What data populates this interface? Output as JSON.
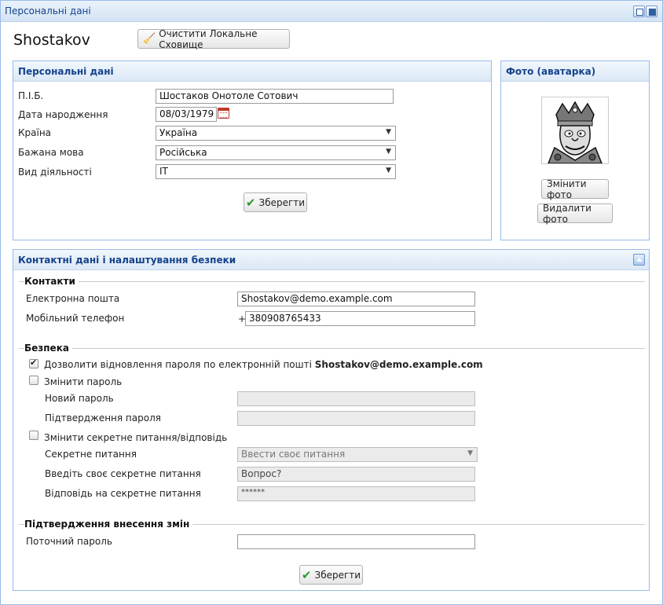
{
  "window": {
    "title": "Персональні дані"
  },
  "header": {
    "user_name": "Shostakov",
    "clear_storage_label": "Очистити Локальне Сховище"
  },
  "personal": {
    "title": "Персональні дані",
    "fields": {
      "fio_label": "П.І.Б.",
      "fio_value": "Шостаков Онотоле Сотович",
      "birth_label": "Дата народження",
      "birth_value": "08/03/1979",
      "country_label": "Країна",
      "country_value": "Україна",
      "language_label": "Бажана мова",
      "language_value": "Російська",
      "activity_label": "Вид діяльності",
      "activity_value": "IT"
    },
    "save_label": "Зберегти"
  },
  "photo": {
    "title": "Фото (аватарка)",
    "change_label": "Змінити фото",
    "delete_label": "Видалити фото"
  },
  "contact": {
    "title": "Контактні дані і налаштування безпеки",
    "contacts": {
      "section_title": "Контакти",
      "email_label": "Електронна пошта",
      "email_value": "Shostakov@demo.example.com",
      "phone_label": "Мобільний телефон",
      "phone_prefix": "+",
      "phone_value": "380908765433"
    },
    "security": {
      "section_title": "Безпека",
      "recovery_label": "Дозволити відновлення пароля по електронній пошті",
      "recovery_email": "Shostakov@demo.example.com",
      "change_password_label": "Змінити пароль",
      "new_password_label": "Новий пароль",
      "confirm_password_label": "Підтвердження пароля",
      "change_secret_label": "Змінити секретне питання/відповідь",
      "secret_question_label": "Секретне питання",
      "secret_question_value": "Ввести своє питання",
      "own_question_label": "Введіть своє секретне питання",
      "own_question_value": "Вопрос?",
      "answer_label": "Відповідь на секретне питання",
      "answer_value": "******"
    },
    "confirm": {
      "section_title": "Підтвердження внесення змін",
      "current_password_label": "Поточний пароль"
    },
    "save_label": "Зберегти"
  }
}
